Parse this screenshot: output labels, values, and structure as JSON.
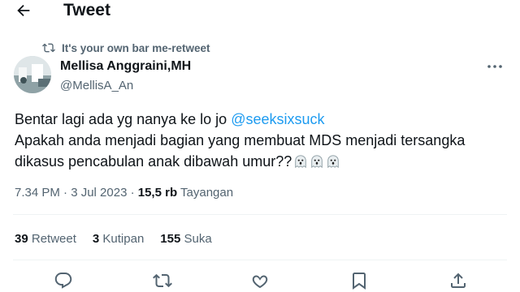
{
  "header": {
    "title": "Tweet"
  },
  "retweet_note": "It's your own bar me-retweet",
  "author": {
    "name": "Mellisa Anggraini,MH",
    "handle": "@MellisA_An"
  },
  "tweet": {
    "line1_prefix": "Bentar lagi ada yg nanya ke lo jo ",
    "mention": "@seeksixsuck",
    "line2": "Apakah anda menjadi bagian yang membuat MDS menjadi tersangka",
    "line3": "dikasus pencabulan anak dibawah umur??"
  },
  "meta": {
    "time": "7.34 PM · 3 Jul 2023 · ",
    "views": "15,5 rb",
    "views_label": "Tayangan"
  },
  "stats": {
    "retweets": "39",
    "retweets_label": "Retweet",
    "quotes": "3",
    "quotes_label": "Kutipan",
    "likes": "155",
    "likes_label": "Suka"
  },
  "icons": [
    "back-arrow-icon",
    "retweet-icon",
    "more-icon",
    "ghost-emoji-icon",
    "reply-icon",
    "retweet-icon",
    "like-icon",
    "bookmark-icon",
    "share-icon"
  ]
}
